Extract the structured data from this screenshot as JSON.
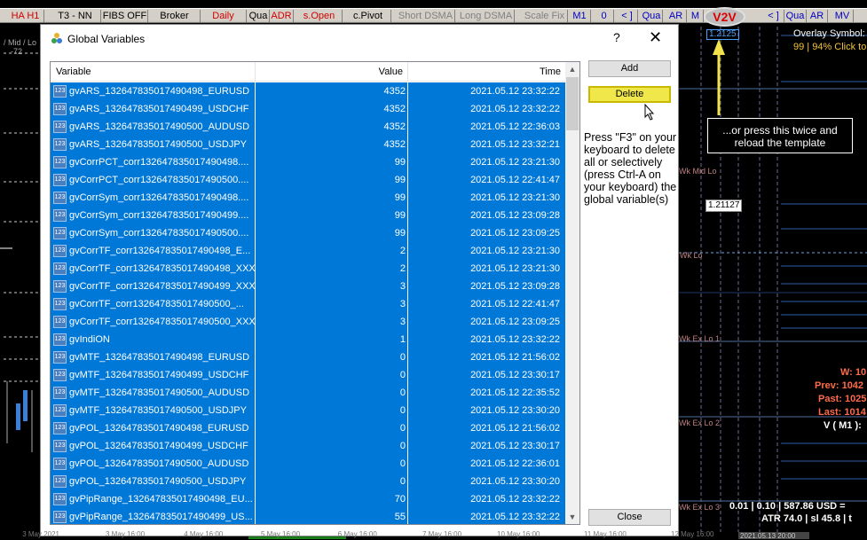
{
  "toolbar": {
    "items": [
      "HA H1",
      "T3 - NN",
      "FIBS OFF",
      "Broker",
      "Daily",
      "Qua",
      "ADR",
      "s.Open",
      "c.Pivot",
      "Short DSMA",
      "Long DSMA",
      "Scale Fix",
      "M1",
      "0",
      "< ]",
      "Qua",
      "AR",
      "M",
      "< ]",
      "Qua",
      "AR",
      "MV"
    ]
  },
  "logo_text": "V2V",
  "left_labels": {
    "mid_lo": "/ Mid / Lo",
    "num": "-72"
  },
  "dialog": {
    "title": "Global Variables",
    "help": "?",
    "close_glyph": "✕",
    "columns": {
      "variable": "Variable",
      "value": "Value",
      "time": "Time"
    },
    "rows": [
      {
        "name": "gvARS_132647835017490498_EURUSD",
        "value": "4352",
        "time": "2021.05.12 23:32:22"
      },
      {
        "name": "gvARS_132647835017490499_USDCHF",
        "value": "4352",
        "time": "2021.05.12 23:32:22"
      },
      {
        "name": "gvARS_132647835017490500_AUDUSD",
        "value": "4352",
        "time": "2021.05.12 22:36:03"
      },
      {
        "name": "gvARS_132647835017490500_USDJPY",
        "value": "4352",
        "time": "2021.05.12 23:32:21"
      },
      {
        "name": "gvCorrPCT_corr132647835017490498....",
        "value": "99",
        "time": "2021.05.12 23:21:30"
      },
      {
        "name": "gvCorrPCT_corr132647835017490500....",
        "value": "99",
        "time": "2021.05.12 22:41:47"
      },
      {
        "name": "gvCorrSym_corr132647835017490498....",
        "value": "99",
        "time": "2021.05.12 23:21:30"
      },
      {
        "name": "gvCorrSym_corr132647835017490499....",
        "value": "99",
        "time": "2021.05.12 23:09:28"
      },
      {
        "name": "gvCorrSym_corr132647835017490500....",
        "value": "99",
        "time": "2021.05.12 23:09:25"
      },
      {
        "name": "gvCorrTF_corr132647835017490498_E...",
        "value": "2",
        "time": "2021.05.12 23:21:30"
      },
      {
        "name": "gvCorrTF_corr132647835017490498_XXX",
        "value": "2",
        "time": "2021.05.12 23:21:30"
      },
      {
        "name": "gvCorrTF_corr132647835017490499_XXX",
        "value": "3",
        "time": "2021.05.12 23:09:28"
      },
      {
        "name": "gvCorrTF_corr132647835017490500_...",
        "value": "3",
        "time": "2021.05.12 22:41:47"
      },
      {
        "name": "gvCorrTF_corr132647835017490500_XXX",
        "value": "3",
        "time": "2021.05.12 23:09:25"
      },
      {
        "name": "gvIndiON",
        "value": "1",
        "time": "2021.05.12 23:32:22"
      },
      {
        "name": "gvMTF_132647835017490498_EURUSD",
        "value": "0",
        "time": "2021.05.12 21:56:02"
      },
      {
        "name": "gvMTF_132647835017490499_USDCHF",
        "value": "0",
        "time": "2021.05.12 23:30:17"
      },
      {
        "name": "gvMTF_132647835017490500_AUDUSD",
        "value": "0",
        "time": "2021.05.12 22:35:52"
      },
      {
        "name": "gvMTF_132647835017490500_USDJPY",
        "value": "0",
        "time": "2021.05.12 23:30:20"
      },
      {
        "name": "gvPOL_132647835017490498_EURUSD",
        "value": "0",
        "time": "2021.05.12 21:56:02"
      },
      {
        "name": "gvPOL_132647835017490499_USDCHF",
        "value": "0",
        "time": "2021.05.12 23:30:17"
      },
      {
        "name": "gvPOL_132647835017490500_AUDUSD",
        "value": "0",
        "time": "2021.05.12 22:36:01"
      },
      {
        "name": "gvPOL_132647835017490500_USDJPY",
        "value": "0",
        "time": "2021.05.12 23:30:20"
      },
      {
        "name": "gvPipRange_132647835017490498_EU...",
        "value": "70",
        "time": "2021.05.12 23:32:22"
      },
      {
        "name": "gvPipRange_132647835017490499_US...",
        "value": "55",
        "time": "2021.05.12 23:32:22"
      }
    ],
    "row_icon_text": "123",
    "buttons": {
      "add": "Add",
      "delete": "Delete",
      "close": "Close"
    },
    "note": "Press \"F3\" on your keyboard to delete all or selectively (press Ctrl-A on your keyboard) the global variable(s)"
  },
  "callout": "...or press this twice and reload the template",
  "chart_right": {
    "overlay_symbol": "Overlay Symbol:",
    "overlay_stats": "99 | 94% Click to",
    "price_tag_top": "1.2125",
    "price_box": "1.21127",
    "wk_mid_lo": "Wk Mid Lo",
    "wk_lo": "Wk Lo",
    "wk_ex_lo_1": "Wk Ex Lo 1",
    "wk_ex_lo_2": "Wk Ex Lo 2",
    "wk_ex_lo_3": "Wk Ex Lo 3",
    "w": "W: 10",
    "prev": "Prev: 1042",
    "past": "Past: 1025",
    "last": "Last: 1014",
    "vm1": "V ( M1 ):",
    "bottom1": "0.01 | 0.10 | 587.86 USD =",
    "bottom2": "ATR 74.0 | sl 45.8 | t",
    "time_label": "2021.05.13 20:00"
  },
  "bottom_axis": [
    "3 May 2021",
    "3 May 16:00",
    "4 May 16:00",
    "5 May 16:00",
    "6 May 16:00",
    "7 May 16:00",
    "10 May 16:00",
    "11 May 16:00",
    "12 May 16:00"
  ],
  "colors": {
    "selection": "#0078d7",
    "delete_button": "#f0e84a",
    "accent_red": "#ff6a4a"
  }
}
